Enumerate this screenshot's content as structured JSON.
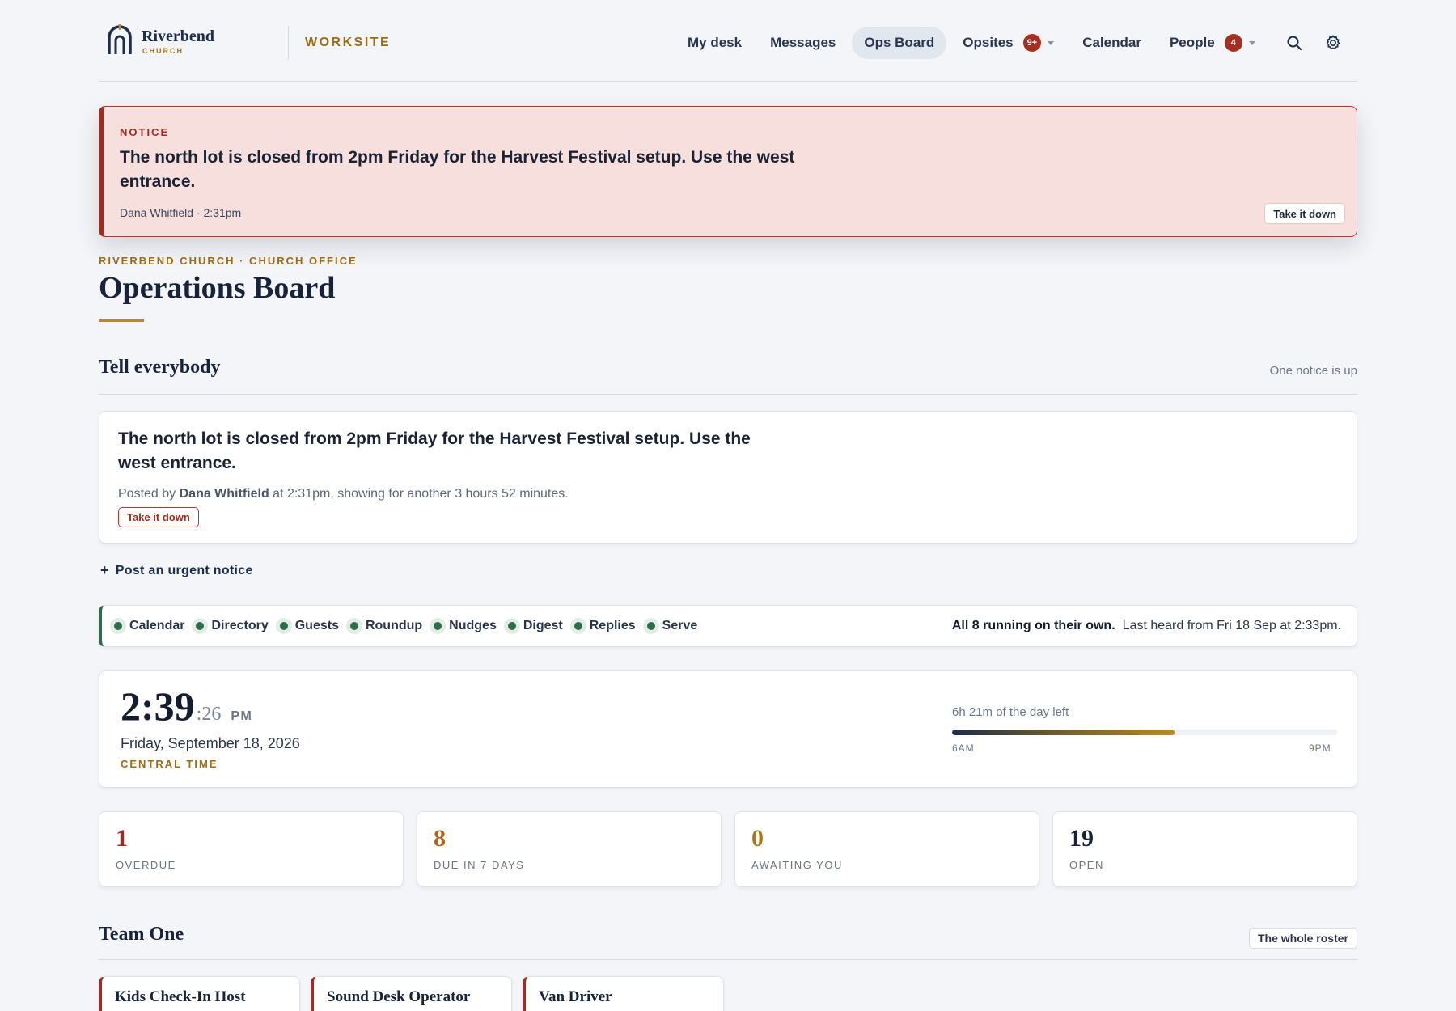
{
  "brand": {
    "name": "Riverbend",
    "sub": "CHURCH",
    "app": "WORKSITE"
  },
  "nav": {
    "items": [
      {
        "label": "My desk"
      },
      {
        "label": "Messages"
      },
      {
        "label": "Ops Board",
        "active": true
      },
      {
        "label": "Opsites",
        "badge": "9+"
      },
      {
        "label": "Calendar"
      },
      {
        "label": "People",
        "badge": "4"
      }
    ],
    "icons": [
      "search-icon",
      "gear-icon"
    ]
  },
  "banner": {
    "label": "NOTICE",
    "message": "The north lot is closed from 2pm Friday for the Harvest Festival setup. Use the west entrance.",
    "meta": "Dana Whitfield · 2:31pm",
    "action": "Take it down"
  },
  "page": {
    "breadcrumb": "RIVERBEND CHURCH · CHURCH OFFICE",
    "title": "Operations Board"
  },
  "tell_everybody": {
    "title": "Tell everybody",
    "status": "One notice is up",
    "notice": {
      "message": "The north lot is closed from 2pm Friday for the Harvest Festival setup. Use the west entrance.",
      "meta_prefix": "Posted by ",
      "author": "Dana Whitfield",
      "meta_suffix": " at 2:31pm, showing for another 3 hours 52 minutes.",
      "action": "Take it down"
    },
    "post_link": "Post an urgent notice"
  },
  "services": {
    "items": [
      "Calendar",
      "Directory",
      "Guests",
      "Roundup",
      "Nudges",
      "Digest",
      "Replies",
      "Serve"
    ],
    "status_bold": "All 8 running on their own.",
    "status_text": "Last heard from Fri 18 Sep at 2:33pm."
  },
  "clock": {
    "hm": "2:39",
    "sec": ":26",
    "ampm": "PM",
    "date": "Friday, September 18, 2026",
    "tz": "CENTRAL TIME",
    "remaining": "6h 21m of the day left",
    "start": "6AM",
    "end": "9PM",
    "progress": 0.577
  },
  "stats": [
    {
      "value": "1",
      "label": "OVERDUE",
      "color": "#a32a20"
    },
    {
      "value": "8",
      "label": "DUE IN 7 DAYS",
      "color": "#b5621a"
    },
    {
      "value": "0",
      "label": "AWAITING YOU",
      "color": "#a6791e"
    },
    {
      "value": "19",
      "label": "OPEN",
      "color": "#18233a"
    }
  ],
  "team": {
    "title": "Team One",
    "action": "The whole roster",
    "roles": [
      "Kids Check-In Host",
      "Sound Desk Operator",
      "Van Driver"
    ]
  },
  "colors": {
    "accent": "#b98a2b",
    "danger": "#a32a20",
    "ok": "#2e6b4b",
    "navy": "#1e2d4a"
  }
}
